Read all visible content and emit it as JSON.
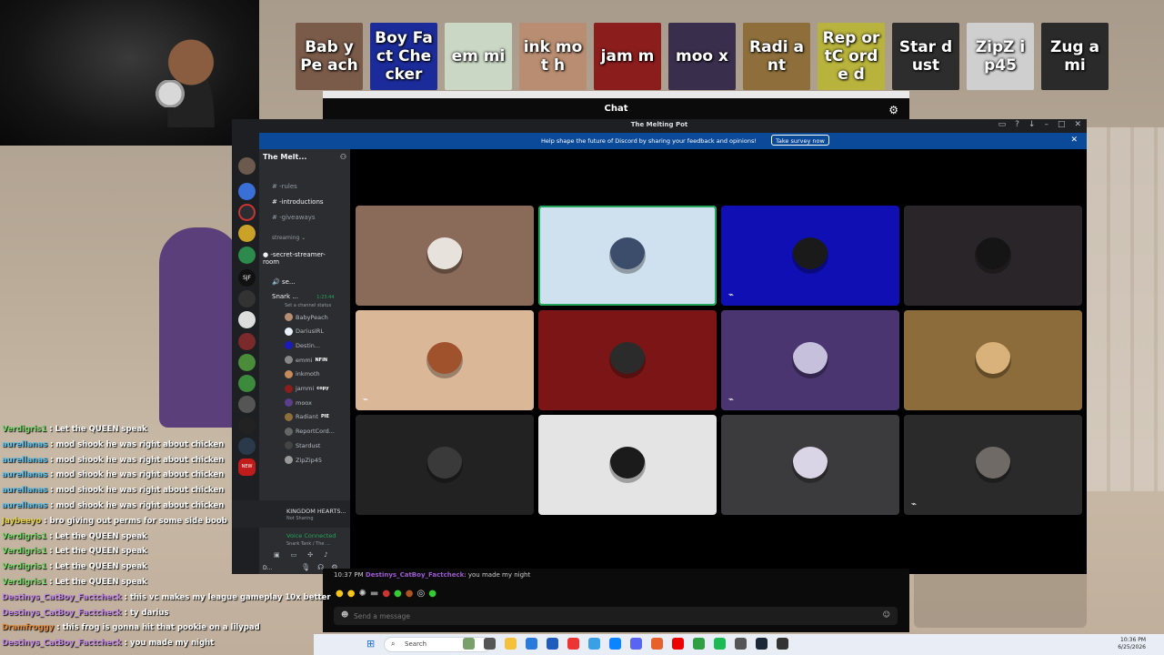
{
  "top_participants": [
    {
      "name": "BabyPeach",
      "label": "Bab yPe ach",
      "color": "#7a5a48"
    },
    {
      "name": "DestinysCatBoyFactChecker",
      "label": "Boy Fact Che cker",
      "color": "#1b2c9a"
    },
    {
      "name": "emmi",
      "label": "em mi",
      "color": "#c9d7c4"
    },
    {
      "name": "inkmoth",
      "label": "ink mot h",
      "color": "#b88d71"
    },
    {
      "name": "jammm",
      "label": "jam m",
      "color": "#8b1d1d"
    },
    {
      "name": "moox",
      "label": "moo x",
      "color": "#3a2e4d"
    },
    {
      "name": "Radiant",
      "label": "Radi ant",
      "color": "#8e6f3b"
    },
    {
      "name": "ReportCorded",
      "label": "Rep ortC orde d",
      "color": "#b8b33c"
    },
    {
      "name": "Stardust",
      "label": "Star dust",
      "color": "#2d2d2d"
    },
    {
      "name": "ZipZip45",
      "label": "ZipZ ip45",
      "color": "#cfcfcf"
    },
    {
      "name": "Zugami",
      "label": "Zug ami",
      "color": "#2a2a2a"
    }
  ],
  "chat_window": {
    "title": "Chat"
  },
  "discord": {
    "window_title": "The Melting Pot",
    "banner_text": "Help shape the future of Discord by sharing your feedback and opinions!",
    "banner_button": "Take survey now",
    "server_name": "The Melt...",
    "channels": [
      {
        "name": "rules",
        "label": "-rules"
      },
      {
        "name": "introductions",
        "label": "-introductions"
      },
      {
        "name": "giveaways",
        "label": "-giveaways"
      }
    ],
    "category": "streaming",
    "stream_channel": "-secret-streamer-room",
    "voice_channel": "se...",
    "voice_user": {
      "name": "Snark ...",
      "timer": "1:23:44",
      "status": "Set a channel status"
    },
    "members": [
      {
        "name": "BabyPeach",
        "color": "#b88d71",
        "tag": ""
      },
      {
        "name": "DariusIRL",
        "color": "#e9f1fa",
        "tag": ""
      },
      {
        "name": "Destin...",
        "color": "#1b1bbd",
        "tag": ""
      },
      {
        "name": "emmi",
        "color": "#888",
        "tag": "NFIN"
      },
      {
        "name": "inkmoth",
        "color": "#c78a5a",
        "tag": ""
      },
      {
        "name": "jammi",
        "color": "#8b1d1d",
        "tag": "copy"
      },
      {
        "name": "moox",
        "color": "#5b3f8a",
        "tag": ""
      },
      {
        "name": "Radiant",
        "color": "#8e6f3b",
        "tag": "PIE"
      },
      {
        "name": "ReportCord...",
        "color": "#666",
        "tag": ""
      },
      {
        "name": "Stardust",
        "color": "#444",
        "tag": ""
      },
      {
        "name": "ZipZip45",
        "color": "#999",
        "tag": ""
      }
    ],
    "now_playing": {
      "title": "KINGDOM HEARTS...",
      "sub": "Not Sharing"
    },
    "voice_connected": {
      "label": "Voice Connected",
      "sub": "Snark Tank / The ..."
    },
    "user_panel": {
      "name": "D..."
    },
    "grid": [
      {
        "name": "tile-1",
        "bg": "#8a6a58",
        "pic": "#e8e2dc",
        "muted": false,
        "speaking": false
      },
      {
        "name": "tile-2",
        "bg": "#cfe0ee",
        "pic": "#3b4d6a",
        "muted": false,
        "speaking": true
      },
      {
        "name": "tile-3",
        "bg": "#0f0fb4",
        "pic": "#1a1a1a",
        "muted": true,
        "speaking": false
      },
      {
        "name": "tile-4",
        "bg": "#2a2528",
        "pic": "#151515",
        "muted": false,
        "speaking": false
      },
      {
        "name": "tile-5",
        "bg": "#d9b797",
        "pic": "#a0522d",
        "muted": true,
        "speaking": false
      },
      {
        "name": "tile-6",
        "bg": "#7c1616",
        "pic": "#2b2b2b",
        "muted": false,
        "speaking": false
      },
      {
        "name": "tile-7",
        "bg": "#4a3570",
        "pic": "#c6c0dd",
        "muted": true,
        "speaking": false
      },
      {
        "name": "tile-8",
        "bg": "#8c6c3a",
        "pic": "#d8b27a",
        "muted": false,
        "speaking": false
      },
      {
        "name": "tile-9",
        "bg": "#222222",
        "pic": "#3a3a3a",
        "muted": false,
        "speaking": false
      },
      {
        "name": "tile-10",
        "bg": "#e4e4e4",
        "pic": "#1b1b1b",
        "muted": false,
        "speaking": false
      },
      {
        "name": "tile-11",
        "bg": "#3b3b3d",
        "pic": "#d9d4e6",
        "muted": false,
        "speaking": false
      },
      {
        "name": "tile-12",
        "bg": "#2a2a2a",
        "pic": "#6f6a66",
        "muted": true,
        "speaking": false
      }
    ]
  },
  "chat_bottom": {
    "last_line_time": "10:37 PM",
    "last_line_user": "Destinys_CatBoy_Factcheck",
    "last_line_text": "you made my night",
    "placeholder": "Send a message"
  },
  "stream_chat": [
    {
      "user": "Verdigris1",
      "user_color": "#7bd86a",
      "text": "Let the QUEEN speak"
    },
    {
      "user": "aurellanas",
      "user_color": "#5bc0eb",
      "text": "mod shook he was right about chicken"
    },
    {
      "user": "aurellanas",
      "user_color": "#5bc0eb",
      "text": "mod shook he was right about chicken"
    },
    {
      "user": "aurellanas",
      "user_color": "#5bc0eb",
      "text": "mod shook he was right about chicken"
    },
    {
      "user": "aurellanas",
      "user_color": "#5bc0eb",
      "text": "mod shook he was right about chicken"
    },
    {
      "user": "aurellanas",
      "user_color": "#5bc0eb",
      "text": "mod shook he was right about chicken"
    },
    {
      "user": "Jaybeeyo",
      "user_color": "#e6d24a",
      "text": "bro giving out perms for some side boob"
    },
    {
      "user": "Verdigris1",
      "user_color": "#7bd86a",
      "text": "Let the QUEEN speak"
    },
    {
      "user": "Verdigris1",
      "user_color": "#7bd86a",
      "text": "Let the QUEEN speak"
    },
    {
      "user": "Verdigris1",
      "user_color": "#7bd86a",
      "text": "Let the QUEEN speak"
    },
    {
      "user": "Verdigris1",
      "user_color": "#7bd86a",
      "text": "Let the QUEEN speak"
    },
    {
      "user": "Destinys_CatBoy_Factcheck",
      "user_color": "#c48ae6",
      "text": "this vc makes my league gameplay 10x better"
    },
    {
      "user": "Destinys_CatBoy_Factcheck",
      "user_color": "#c48ae6",
      "text": "ty darius"
    },
    {
      "user": "Dramfroggy",
      "user_color": "#e08a3c",
      "text": "this frog is gonna hit that pookie on a lilypad"
    },
    {
      "user": "Destinys_CatBoy_Factcheck",
      "user_color": "#c48ae6",
      "text": "you made my night"
    }
  ],
  "taskbar": {
    "search_placeholder": "Search",
    "time": "10:36 PM",
    "date": "6/25/2026"
  }
}
